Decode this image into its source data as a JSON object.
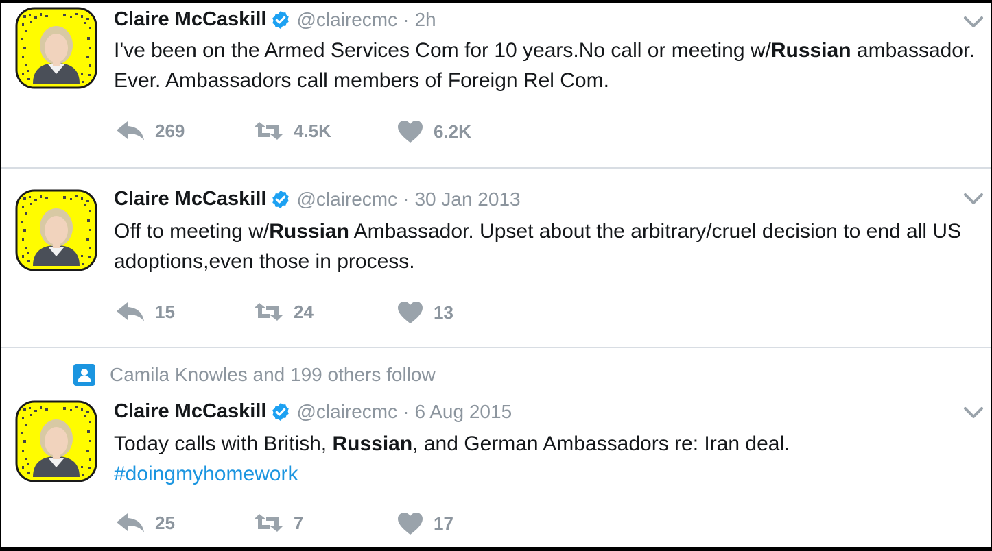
{
  "colors": {
    "verified": "#1da1f2",
    "hashtag": "#1b95e0",
    "avatar_bg": "#fffc00",
    "muted": "#8c959e"
  },
  "tweets": [
    {
      "name": "Claire McCaskill",
      "handle": "@clairecmc",
      "separator": "·",
      "time": "2h",
      "segments": [
        {
          "text": "I've been on the Armed Services Com for 10 years.No call or meeting w/"
        },
        {
          "text": "Russian",
          "bold": true
        },
        {
          "text": " ambassador. Ever. Ambassadors call members of Foreign Rel Com."
        }
      ],
      "replies": "269",
      "retweets": "4.5K",
      "likes": "6.2K"
    },
    {
      "name": "Claire McCaskill",
      "handle": "@clairecmc",
      "separator": "·",
      "time": "30 Jan 2013",
      "segments": [
        {
          "text": "Off to meeting w/"
        },
        {
          "text": "Russian",
          "bold": true
        },
        {
          "text": " Ambassador. Upset about the arbitrary/cruel decision to end all US adoptions,even those in process."
        }
      ],
      "replies": "15",
      "retweets": "24",
      "likes": "13"
    },
    {
      "context": "Camila Knowles and 199 others follow",
      "name": "Claire McCaskill",
      "handle": "@clairecmc",
      "separator": "·",
      "time": "6 Aug 2015",
      "segments": [
        {
          "text": "Today calls with British, "
        },
        {
          "text": "Russian",
          "bold": true
        },
        {
          "text": ", and German Ambassadors re: Iran deal. "
        },
        {
          "text": "#doingmyhomework",
          "hashtag": true
        }
      ],
      "replies": "25",
      "retweets": "7",
      "likes": "17"
    }
  ]
}
